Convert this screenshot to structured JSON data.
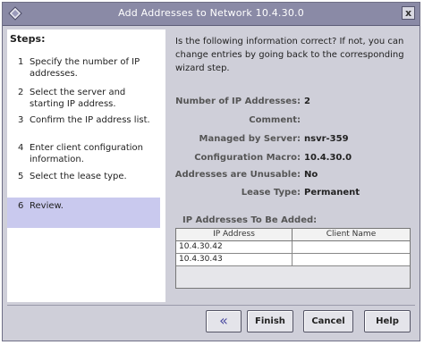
{
  "window": {
    "title": "Add Addresses to Network 10.4.30.0",
    "close_label": "x",
    "icon": "diamond-icon"
  },
  "steps": {
    "heading": "Steps:",
    "items": [
      {
        "num": "1",
        "text": "Specify the number of IP addresses."
      },
      {
        "num": "2",
        "text": "Select the server and starting IP address."
      },
      {
        "num": "3",
        "text": "Confirm the IP address list."
      },
      {
        "num": "4",
        "text": "Enter client configuration information."
      },
      {
        "num": "5",
        "text": "Select the lease type."
      },
      {
        "num": "6",
        "text": "Review."
      }
    ],
    "active_index": 6
  },
  "review": {
    "intro": "Is the following information correct? If not, you can change entries by going back to the corresponding wizard step.",
    "fields": [
      {
        "label": "Number of IP Addresses:",
        "value": "2"
      },
      {
        "label": "Comment:",
        "value": ""
      },
      {
        "label": "Managed by Server:",
        "value": "nsvr-359"
      },
      {
        "label": "Configuration Macro:",
        "value": "10.4.30.0"
      },
      {
        "label": "Addresses are Unusable:",
        "value": "No"
      },
      {
        "label": "Lease Type:",
        "value": "Permanent"
      }
    ]
  },
  "addresses": {
    "title": "IP Addresses To Be Added:",
    "columns": [
      "IP Address",
      "Client Name"
    ],
    "rows": [
      [
        "10.4.30.42",
        ""
      ],
      [
        "10.4.30.43",
        ""
      ]
    ]
  },
  "buttons": {
    "back": "«",
    "finish": "Finish",
    "cancel": "Cancel",
    "help": "Help"
  },
  "colors": {
    "titlebar": "#8a8aa6",
    "active_step": "#c9c9ee",
    "panel": "#cfcfd9"
  }
}
